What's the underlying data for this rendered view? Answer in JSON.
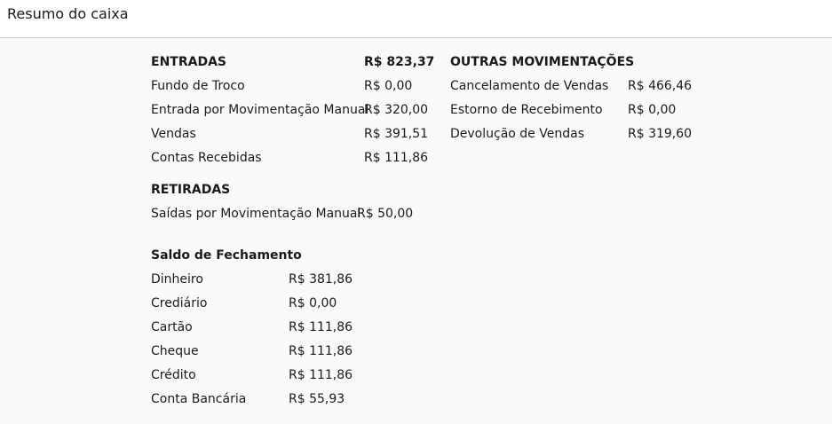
{
  "header": {
    "title": "Resumo do caixa"
  },
  "entradas": {
    "heading": "ENTRADAS",
    "total": "R$ 823,37",
    "items": [
      {
        "label": "Fundo de Troco",
        "value": "R$ 0,00"
      },
      {
        "label": "Entrada por Movimentação Manual",
        "value": "R$ 320,00"
      },
      {
        "label": "Vendas",
        "value": "R$ 391,51"
      },
      {
        "label": "Contas Recebidas",
        "value": "R$ 111,86"
      }
    ]
  },
  "outras": {
    "heading": "OUTRAS MOVIMENTAÇÕES",
    "items": [
      {
        "label": "Cancelamento de Vendas",
        "value": "R$ 466,46"
      },
      {
        "label": "Estorno de Recebimento",
        "value": "R$ 0,00"
      },
      {
        "label": "Devolução de Vendas",
        "value": "R$ 319,60"
      }
    ]
  },
  "retiradas": {
    "heading": "RETIRADAS",
    "items": [
      {
        "label": "Saídas por Movimentação Manual",
        "value": "R$ 50,00"
      }
    ]
  },
  "saldo": {
    "heading": "Saldo de Fechamento",
    "items": [
      {
        "label": "Dinheiro",
        "value": "R$ 381,86"
      },
      {
        "label": "Crediário",
        "value": "R$ 0,00"
      },
      {
        "label": "Cartão",
        "value": "R$ 111,86"
      },
      {
        "label": "Cheque",
        "value": "R$ 111,86"
      },
      {
        "label": "Crédito",
        "value": "R$ 111,86"
      },
      {
        "label": "Conta Bancária",
        "value": "R$ 55,93"
      }
    ]
  }
}
